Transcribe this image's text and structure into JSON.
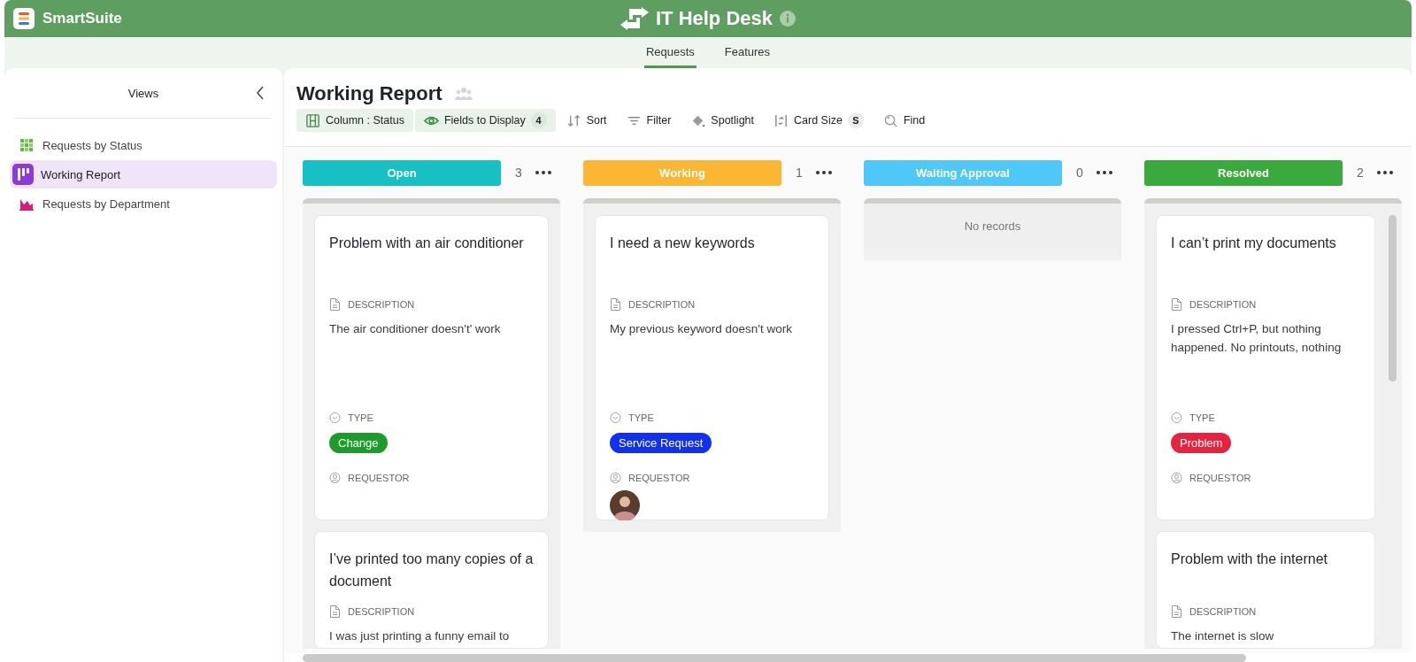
{
  "app": {
    "name": "SmartSuite"
  },
  "header": {
    "title": "IT Help Desk"
  },
  "tabs": [
    {
      "label": "Requests",
      "selected": true
    },
    {
      "label": "Features",
      "selected": false
    }
  ],
  "sidebar": {
    "title": "Views",
    "items": [
      {
        "label": "Requests by Status",
        "kind": "grid",
        "selected": false
      },
      {
        "label": "Working Report",
        "kind": "kanban",
        "selected": true
      },
      {
        "label": "Requests by Department",
        "kind": "chart",
        "selected": false
      }
    ]
  },
  "view": {
    "title": "Working Report",
    "toolbar": [
      {
        "kind": "column",
        "label": "Column : Status",
        "active": true
      },
      {
        "kind": "fields",
        "label": "Fields to Display",
        "badge": "4",
        "active": true
      },
      {
        "kind": "sort",
        "label": "Sort",
        "active": false
      },
      {
        "kind": "filter",
        "label": "Filter",
        "active": false
      },
      {
        "kind": "spotlight",
        "label": "Spotlight",
        "active": false
      },
      {
        "kind": "size",
        "label": "Card Size",
        "badge": "S",
        "active": false
      },
      {
        "kind": "find",
        "label": "Find",
        "active": false
      }
    ]
  },
  "columns": [
    {
      "label": "Open",
      "color": "#17c1c3",
      "count": "3",
      "cards": [
        {
          "title": "Problem with an air conditioner",
          "description_label": "DESCRIPTION",
          "description": "The air conditioner doesn't' work",
          "type_label": "TYPE",
          "type": {
            "label": "Change",
            "color": "#1e9b2a"
          },
          "requestor_label": "REQUESTOR",
          "requestor_avatar": false
        },
        {
          "title": "I’ve printed too many copies of a document",
          "description_label": "DESCRIPTION",
          "description": "I was just printing a funny email to"
        }
      ]
    },
    {
      "label": "Working",
      "color": "#fbb733",
      "count": "1",
      "cards": [
        {
          "title": "I need a new keywords",
          "description_label": "DESCRIPTION",
          "description": "My previous keyword doesn't work",
          "type_label": "TYPE",
          "type": {
            "label": "Service Request",
            "color": "#1230f0"
          },
          "requestor_label": "REQUESTOR",
          "requestor_avatar": true
        }
      ]
    },
    {
      "label": "Waiting Approval",
      "color": "#4fc8f8",
      "count": "0",
      "empty_text": "No records"
    },
    {
      "label": "Resolved",
      "color": "#3aa93e",
      "count": "2",
      "cards": [
        {
          "title": "I can’t print my documents",
          "description_label": "DESCRIPTION",
          "description": "I pressed Ctrl+P, but nothing happened. No printouts, nothing",
          "type_label": "TYPE",
          "type": {
            "label": "Problem",
            "color": "#e8233f"
          },
          "requestor_label": "REQUESTOR",
          "requestor_avatar": false
        },
        {
          "title": "Problem with the internet",
          "description_label": "DESCRIPTION",
          "description": "The internet is slow"
        }
      ]
    }
  ]
}
